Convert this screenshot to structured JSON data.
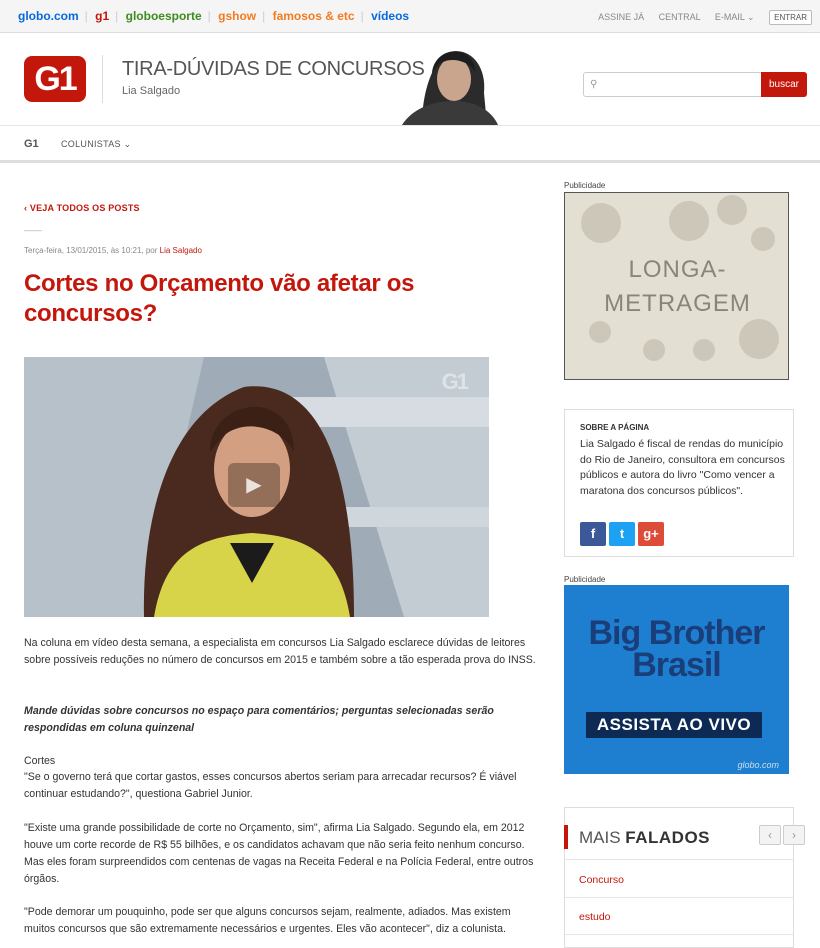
{
  "topbar": {
    "links": [
      "globo.com",
      "g1",
      "globoesporte",
      "gshow",
      "famosos & etc",
      "vídeos"
    ],
    "assine": "ASSINE JÁ",
    "central": "CENTRAL",
    "email": "E-MAIL",
    "entrar": "ENTRAR"
  },
  "header": {
    "logo": "G1",
    "blog_title": "TIRA-DÚVIDAS DE CONCURSOS",
    "author": "Lia Salgado",
    "search_placeholder": "",
    "search_button": "buscar"
  },
  "nav": {
    "g1": "G1",
    "colunistas": "COLUNISTAS"
  },
  "post": {
    "back": "VEJA TODOS OS POSTS",
    "dash": "——",
    "meta_date": "Terça-feira, 13/01/2015, às 10:21, por",
    "meta_author": "Lia Salgado",
    "title": "Cortes no Orçamento vão afetar os concursos?",
    "video_watermark": "G1",
    "p1": "Na coluna em vídeo desta semana, a especialista em concursos Lia Salgado esclarece dúvidas de leitores sobre possíveis reduções no número de concursos em 2015 e também sobre a tão esperada prova do INSS.",
    "p2": "Mande dúvidas sobre concursos no espaço para comentários; perguntas selecionadas serão respondidas em coluna quinzenal",
    "p3_title": "Cortes",
    "p3": "\"Se o governo terá que cortar gastos, esses concursos abertos seriam para arrecadar recursos? É viável continuar estudando?\", questiona Gabriel Junior.",
    "p4": "\"Existe uma grande possibilidade de corte no Orçamento, sim\", afirma Lia Salgado. Segundo ela, em 2012 houve um corte recorde de R$ 55 bilhões, e os candidatos achavam que não seria feito nenhum concurso. Mas eles foram surpreendidos com centenas de vagas na Receita Federal e na Polícia Federal, entre outros órgãos.",
    "p5": "\"Pode demorar um pouquinho, pode ser que alguns concursos sejam, realmente, adiados. Mas existem muitos concursos que são extremamente necessários e urgentes. Eles vão acontecer\", diz a colunista."
  },
  "sidebar": {
    "pub1": "Publicidade",
    "ad1_line1": "LONGA-",
    "ad1_line2": "METRAGEM",
    "about_heading": "SOBRE A PÁGINA",
    "about_text": "Lia Salgado é fiscal de rendas do município do Rio de Janeiro, consultora em concursos públicos e autora do livro \"Como vencer a maratona dos concursos públicos\".",
    "social": [
      "f",
      "t",
      "g+"
    ],
    "pub2": "Publicidade",
    "ad2_line1": "Big Brother",
    "ad2_line2": "Brasil",
    "ad2_live": "ASSISTA AO VIVO",
    "ad2_globo": "globo.com",
    "mais_prefix": "MAIS",
    "mais_strong": "FALADOS",
    "mais_items": [
      "Concurso",
      "estudo"
    ]
  },
  "colors": {
    "brand_red": "#c4170c",
    "facebook": "#3b5998",
    "twitter": "#1da1f2",
    "gplus": "#dd4b39"
  }
}
